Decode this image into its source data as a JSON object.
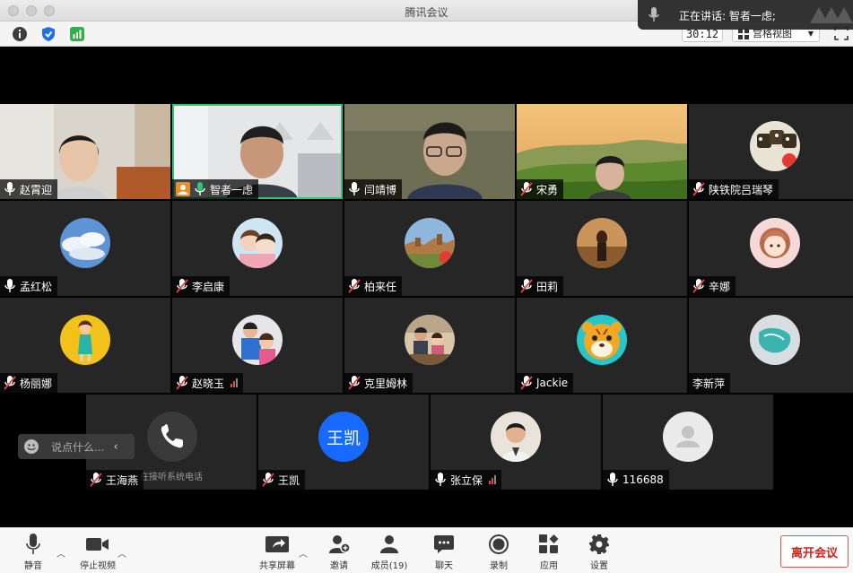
{
  "window": {
    "title": "腾讯会议"
  },
  "toolbar": {
    "timer": "30:12",
    "view_label": "宫格视图"
  },
  "speaking": {
    "label": "正在讲话: 智者一虑;"
  },
  "tiles": [
    {
      "name": "赵霄迎",
      "mic": "on"
    },
    {
      "name": "智者一虑",
      "mic": "on",
      "host": true
    },
    {
      "name": "闫靖博",
      "mic": "on"
    },
    {
      "name": "宋勇",
      "mic": "muted"
    },
    {
      "name": "陕铁院吕瑞琴",
      "mic": "muted"
    },
    {
      "name": "孟红松",
      "mic": "on"
    },
    {
      "name": "李启康",
      "mic": "muted"
    },
    {
      "name": "柏来任",
      "mic": "muted"
    },
    {
      "name": "田莉",
      "mic": "muted"
    },
    {
      "name": "辛娜",
      "mic": "muted"
    },
    {
      "name": "杨丽娜",
      "mic": "muted"
    },
    {
      "name": "赵晓玉",
      "mic": "muted",
      "signal": "weak"
    },
    {
      "name": "克里姆林",
      "mic": "muted"
    },
    {
      "name": "Jackie",
      "mic": "muted"
    },
    {
      "name": "李新萍",
      "mic": "none"
    },
    {
      "name": "王海燕",
      "mic": "muted",
      "status": "在接听系统电话"
    },
    {
      "name": "王凯",
      "mic": "muted",
      "avatar_text": "王凯"
    },
    {
      "name": "张立保",
      "mic": "on",
      "signal": "weak"
    },
    {
      "name": "116688",
      "mic": "on"
    }
  ],
  "chat": {
    "placeholder": "说点什么..."
  },
  "bottom": {
    "mute": "静音",
    "stop_video": "停止视频",
    "share": "共享屏幕",
    "invite": "邀请",
    "members": "成员(19)",
    "chat": "聊天",
    "record": "录制",
    "apps": "应用",
    "settings": "设置",
    "leave": "离开会议"
  },
  "colors": {
    "active_border": "#2ec774",
    "leave_text": "#d0211c",
    "wangkai_avatar": "#1769ff"
  }
}
